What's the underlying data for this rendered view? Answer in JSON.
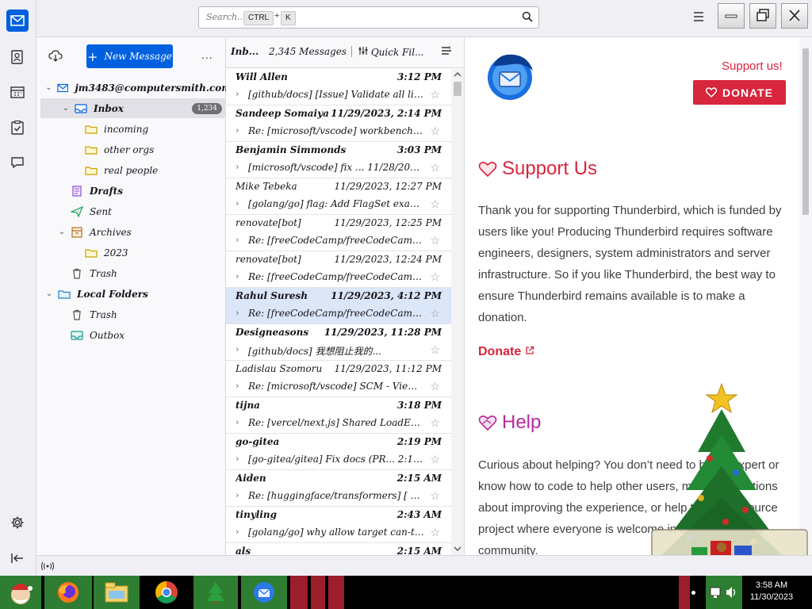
{
  "toolbar": {
    "search_placeholder": "Search...",
    "shortcut_ctrl": "CTRL",
    "shortcut_plus": "+",
    "shortcut_key": "K"
  },
  "folder_pane": {
    "new_message_label": "New Message",
    "more_label": "...",
    "account": "jm3483@computersmith.com",
    "folders": [
      {
        "label": "Inbox",
        "badge": "1,234"
      },
      {
        "label": "incoming"
      },
      {
        "label": "other orgs"
      },
      {
        "label": "real people"
      },
      {
        "label": "Drafts"
      },
      {
        "label": "Sent"
      },
      {
        "label": "Archives"
      },
      {
        "label": "2023"
      },
      {
        "label": "Trash"
      },
      {
        "label": "Local Folders"
      },
      {
        "label": "Trash"
      },
      {
        "label": "Outbox"
      }
    ]
  },
  "message_list": {
    "title": "Inb...",
    "count_label": "2,345 Messages",
    "quick_filter_label": "Quick Fil...",
    "messages": [
      {
        "from": "Will Allen",
        "date": "3:12 PM",
        "subject": "[github/docs] [Issue] Validate all links ...",
        "unread": true
      },
      {
        "from": "Sandeep Somaiya",
        "date": "11/29/2023, 2:14 PM",
        "subject": "Re: [microsoft/vscode] workbench.editor.t...",
        "unread": true
      },
      {
        "from": "Benjamin Simmonds",
        "date": "3:03 PM",
        "subject": "[microsoft/vscode] fix ... 11/28/2023 (P...",
        "unread": true
      },
      {
        "from": "Mike Tebeka",
        "date": "11/29/2023, 12:27 PM",
        "subject": "[golang/go] flag: Add FlagSet example (...",
        "unread": false
      },
      {
        "from": "renovate[bot]",
        "date": "11/29/2023, 12:25 PM",
        "subject": "Re: [freeCodeCamp/freeCodeCamp] fix(dep...",
        "unread": false
      },
      {
        "from": "renovate[bot]",
        "date": "11/29/2023, 12:24 PM",
        "subject": "Re: [freeCodeCamp/freeCodeCamp] chore(...",
        "unread": false
      },
      {
        "from": "Rahul Suresh",
        "date": "11/29/2023, 4:12 PM",
        "subject": "Re: [freeCodeCamp/freeCodeCamp] feat...",
        "unread": true
      },
      {
        "from": "Designeasons",
        "date": "11/29/2023, 11:28 PM",
        "subject": "[github/docs] 我想阻止我的...",
        "unread": true
      },
      {
        "from": "Ladislau Szomoru",
        "date": "11/29/2023, 11:12 PM",
        "subject": "Re: [microsoft/vscode] SCM - View in T...",
        "unread": false
      },
      {
        "from": "tijna",
        "date": "3:18 PM",
        "subject": "Re: [vercel/next.js] Shared LoadError (time...",
        "unread": true
      },
      {
        "from": "go-gitea",
        "date": "2:19 PM",
        "subject": "[go-gitea/gitea] Fix docs (PR... 2:18 ...",
        "unread": true
      },
      {
        "from": "Aiden",
        "date": "2:15 AM",
        "subject": "Re: [huggingface/transformers] [ Llama ]...",
        "unread": true
      },
      {
        "from": "tinyling",
        "date": "2:43 AM",
        "subject": "[golang/go] why allow target can-time-modif...",
        "unread": true
      },
      {
        "from": "als",
        "date": "2:15 AM",
        "subject": "",
        "unread": true
      }
    ]
  },
  "content": {
    "support_link": "Support us!",
    "donate_button": "DONATE",
    "support_heading": "Support Us",
    "support_body": "Thank you for supporting Thunderbird, which is funded by users like you! Producing Thunderbird requires software engineers, designers, system administrators and server infrastructure. So if you like Thunderbird, the best way to ensure Thunderbird remains available is to make a donation.",
    "donate_link": "Donate",
    "help_heading": "Help",
    "help_body": "Curious about helping? You don’t need to be an expert or know how to code to help other users, make suggestions about improving the experience, or help this open source project where everyone is welcome in the Thunderbird community."
  },
  "taskbar": {
    "time": "3:58 AM",
    "date": "11/30/2023"
  },
  "colors": {
    "accent_blue": "#0061e0",
    "thunderbird_red": "#d7263d",
    "help_purple": "#b8299c",
    "selected_row": "#dbe6f8"
  }
}
